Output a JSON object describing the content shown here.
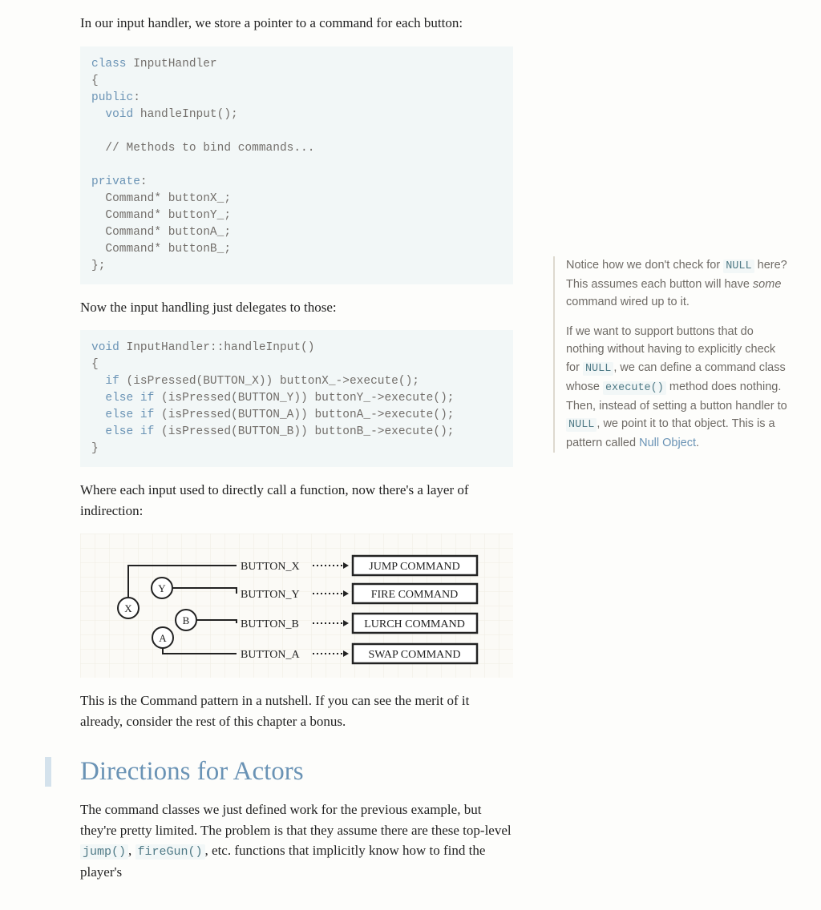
{
  "para1": "In our input handler, we store a pointer to a command for each button:",
  "code1": {
    "l1": "class",
    "l1r": " InputHandler",
    "l2": "{",
    "l3": "public",
    "l3r": ":",
    "l4a": "  ",
    "l4b": "void",
    "l4c": " handleInput();",
    "l5": "",
    "l6": "  // Methods to bind commands...",
    "l7": "",
    "l8": "private",
    "l8r": ":",
    "l9": "  Command* buttonX_;",
    "l10": "  Command* buttonY_;",
    "l11": "  Command* buttonA_;",
    "l12": "  Command* buttonB_;",
    "l13": "};"
  },
  "para2": "Now the input handling just delegates to those:",
  "code2": {
    "l1a": "void",
    "l1b": " InputHandler::handleInput()",
    "l2": "{",
    "l3a": "  ",
    "l3b": "if",
    "l3c": " (isPressed(BUTTON_X)) buttonX_->execute();",
    "l4a": "  ",
    "l4b": "else",
    "l4c": " ",
    "l4d": "if",
    "l4e": " (isPressed(BUTTON_Y)) buttonY_->execute();",
    "l5a": "  ",
    "l5b": "else",
    "l5c": " ",
    "l5d": "if",
    "l5e": " (isPressed(BUTTON_A)) buttonA_->execute();",
    "l6a": "  ",
    "l6b": "else",
    "l6c": " ",
    "l6d": "if",
    "l6e": " (isPressed(BUTTON_B)) buttonB_->execute();",
    "l7": "}"
  },
  "para3": "Where each input used to directly call a function, now there's a layer of indirection:",
  "diagram": {
    "buttons": {
      "x": "X",
      "y": "Y",
      "b": "B",
      "a": "A"
    },
    "labels": {
      "x": "BUTTON_X",
      "y": "BUTTON_Y",
      "b": "BUTTON_B",
      "a": "BUTTON_A"
    },
    "commands": {
      "x": "JUMP COMMAND",
      "y": "FIRE COMMAND",
      "b": "LURCH COMMAND",
      "a": "SWAP COMMAND"
    }
  },
  "para4": "This is the Command pattern in a nutshell. If you can see the merit of it already, consider the rest of this chapter a bonus.",
  "heading2": "Directions for Actors",
  "para5a": "The command classes we just defined work for the previous example, but they're pretty limited. The problem is that they assume there are these top-level ",
  "para5_code1": "jump()",
  "para5_sep": ", ",
  "para5_code2": "fireGun()",
  "para5b": ", etc. functions that implicitly know how to find the player's",
  "aside": {
    "p1a": "Notice how we don't check for ",
    "p1_null": "NULL",
    "p1b": " here? This assumes each button will have ",
    "p1_some": "some",
    "p1c": " command wired up to it.",
    "p2a": "If we want to support buttons that do nothing without having to explicitly check for ",
    "p2_null1": "NULL",
    "p2b": ", we can define a command class whose ",
    "p2_exec": "execute()",
    "p2c": " method does nothing. Then, instead of setting a button handler to ",
    "p2_null2": "NULL",
    "p2d": ", we point it to that object. This is a pattern called ",
    "p2_link": "Null Object",
    "p2e": "."
  }
}
